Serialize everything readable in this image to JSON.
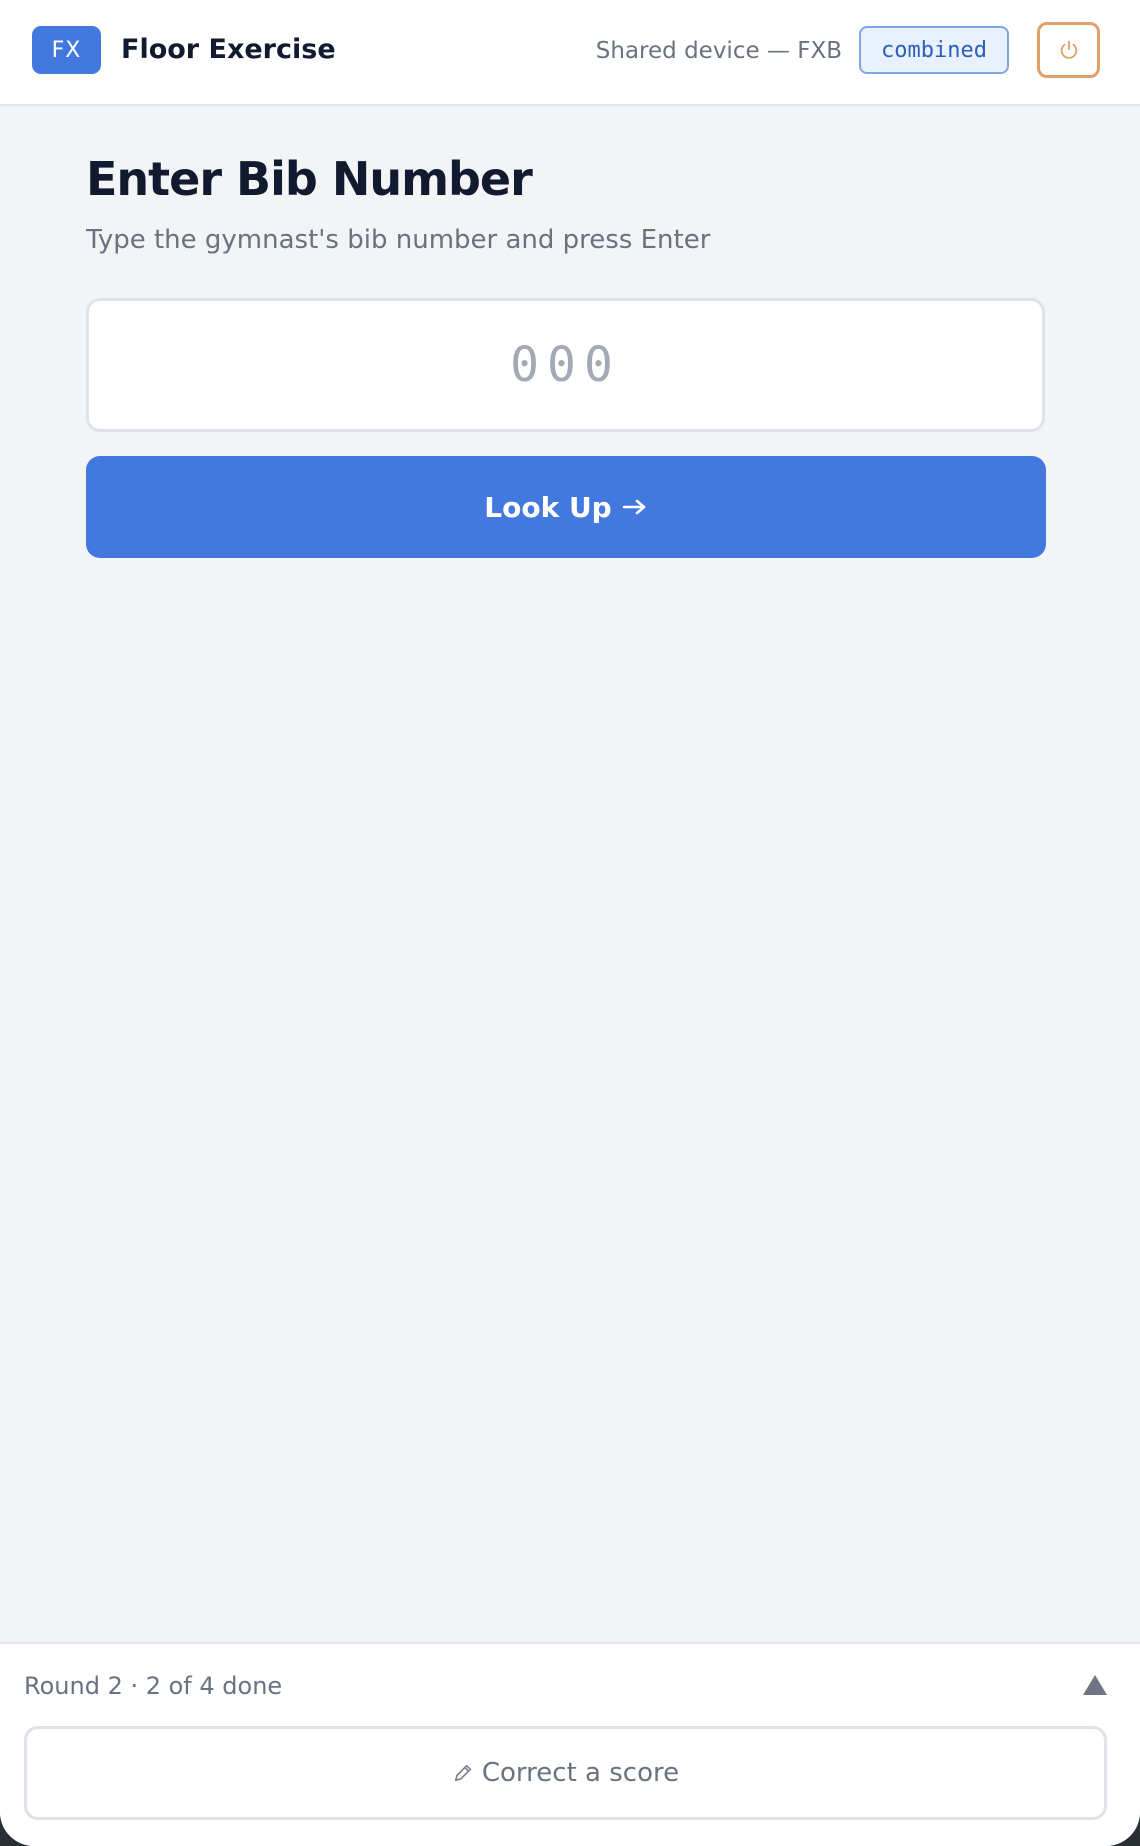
{
  "header": {
    "badge": "FX",
    "title": "Floor Exercise",
    "device": "Shared device — FXB",
    "mode": "combined",
    "power_icon": "power-icon"
  },
  "main": {
    "title": "Enter Bib Number",
    "subtitle": "Type the gymnast's bib number and press Enter",
    "bib_input": {
      "value": "",
      "placeholder": "000"
    },
    "lookup_label": "Look Up",
    "lookup_icon": "arrow-right-icon"
  },
  "footer": {
    "round_status": "Round 2 · 2 of 4 done",
    "expand_icon": "triangle-up-icon",
    "correct_icon": "pencil-icon",
    "correct_label": "Correct a score"
  },
  "colors": {
    "accent": "#4379df",
    "power": "#e0a06a",
    "mode_pill_border": "#7ea6e6",
    "background": "#f2f4f6"
  }
}
